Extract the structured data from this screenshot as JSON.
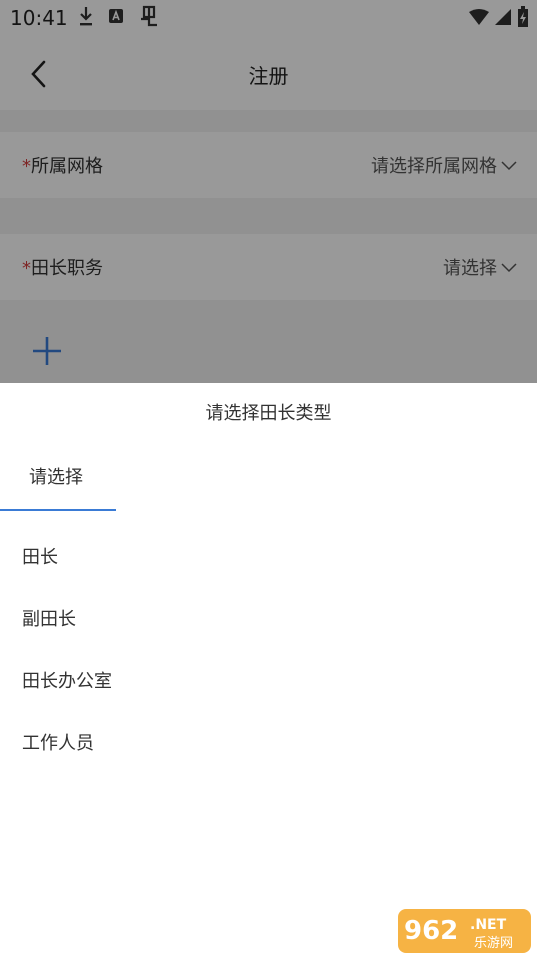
{
  "status": {
    "time": "10:41"
  },
  "nav": {
    "title": "注册",
    "back_icon": "chevron-left-icon"
  },
  "form": {
    "grid": {
      "required": "*",
      "label": "所属网格",
      "value": "请选择所属网格"
    },
    "position": {
      "required": "*",
      "label": "田长职务",
      "value": "请选择"
    },
    "add_icon": "plus-icon"
  },
  "sheet": {
    "title": "请选择田长类型",
    "tab_label": "请选择",
    "options": [
      "田长",
      "副田长",
      "田长办公室",
      "工作人员"
    ]
  },
  "watermark": {
    "text": "962.NET",
    "subtext": "乐游网"
  },
  "colors": {
    "accent": "#3a7bd5",
    "required": "#d23c3c",
    "overlay": "rgba(0,0,0,0.4)"
  }
}
